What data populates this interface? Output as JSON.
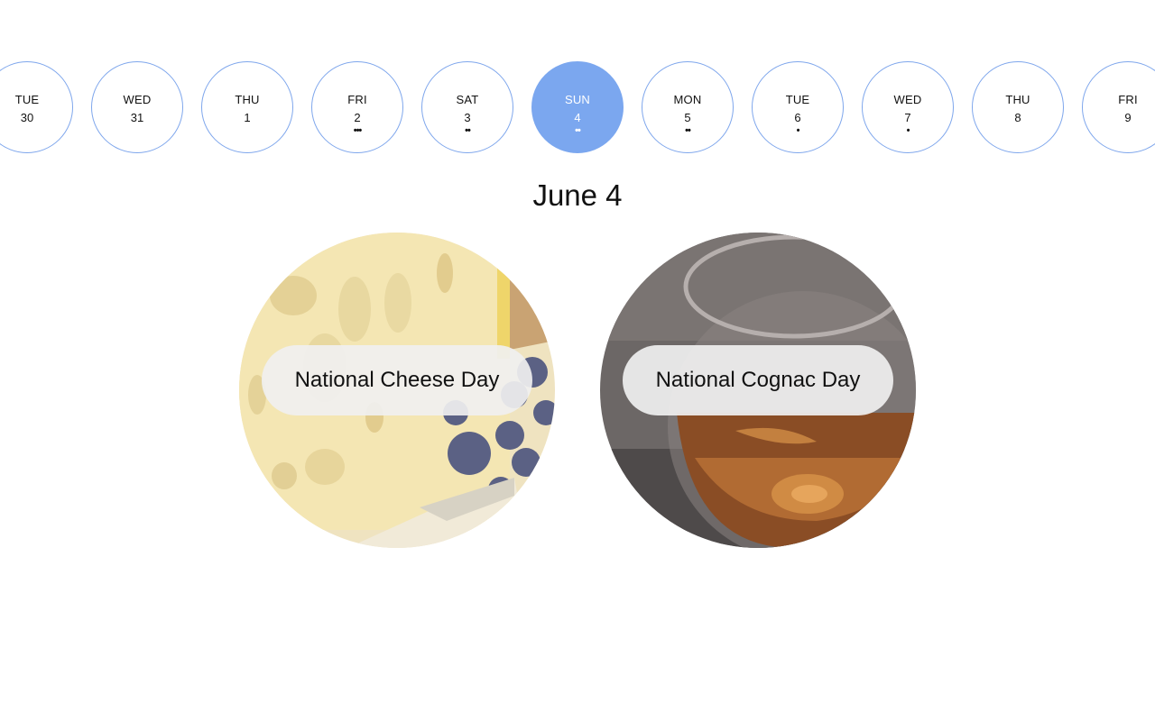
{
  "days": [
    {
      "dow": "TUE",
      "num": "30",
      "dots": ""
    },
    {
      "dow": "WED",
      "num": "31",
      "dots": ""
    },
    {
      "dow": "THU",
      "num": "1",
      "dots": ""
    },
    {
      "dow": "FRI",
      "num": "2",
      "dots": "•••"
    },
    {
      "dow": "SAT",
      "num": "3",
      "dots": "••"
    },
    {
      "dow": "SUN",
      "num": "4",
      "dots": "••"
    },
    {
      "dow": "MON",
      "num": "5",
      "dots": "••"
    },
    {
      "dow": "TUE",
      "num": "6",
      "dots": "•"
    },
    {
      "dow": "WED",
      "num": "7",
      "dots": "•"
    },
    {
      "dow": "THU",
      "num": "8",
      "dots": ""
    },
    {
      "dow": "FRI",
      "num": "9",
      "dots": ""
    }
  ],
  "selected_day_index": 5,
  "selected_date_title": "June 4",
  "events": [
    {
      "label": "National Cheese Day",
      "image": "cheese-and-grapes-photo"
    },
    {
      "label": "National Cognac Day",
      "image": "cognac-glass-photo"
    }
  ],
  "colors": {
    "accent": "#7ba7ef",
    "day_border": "#7ea6ec",
    "pill_bg": "#f0f0f0"
  }
}
